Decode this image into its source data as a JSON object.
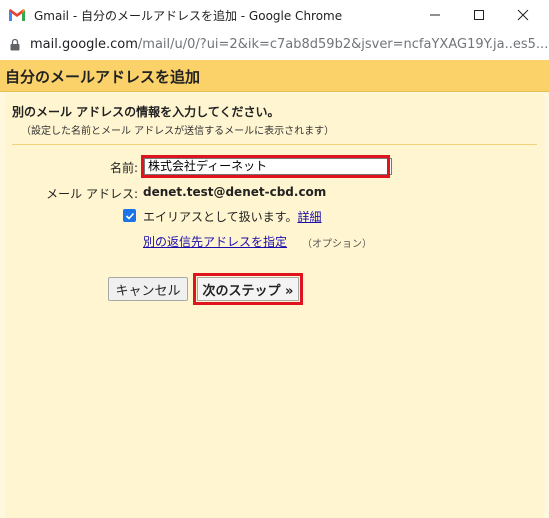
{
  "window": {
    "title": "Gmail - 自分のメールアドレスを追加 - Google Chrome",
    "url_domain": "mail.google.com",
    "url_path": "/mail/u/0/?ui=2&ik=c7ab8d59b2&jsver=ncfaYXAG19Y.ja..es5..."
  },
  "dialog": {
    "header": "自分のメールアドレスを追加",
    "instruction": "別のメール アドレスの情報を入力してください。",
    "subinstruction": "（設定した名前とメール アドレスが送信するメールに表示されます）",
    "name_label": "名前:",
    "name_value": "株式会社ディーネット",
    "email_label": "メール アドレス:",
    "email_value": "denet.test@denet-cbd.com",
    "alias_checked": true,
    "alias_label": "エイリアスとして扱います。",
    "details_link": "詳細",
    "reply_link": "別の返信先アドレスを指定",
    "optional": "（オプション）",
    "cancel_label": "キャンセル",
    "next_label": "次のステップ »"
  },
  "colors": {
    "header_bg": "#fbd26a",
    "panel_bg": "#fff5d1",
    "highlight": "#e0141e",
    "link": "#1a0dab",
    "checkbox": "#1a73e8"
  }
}
